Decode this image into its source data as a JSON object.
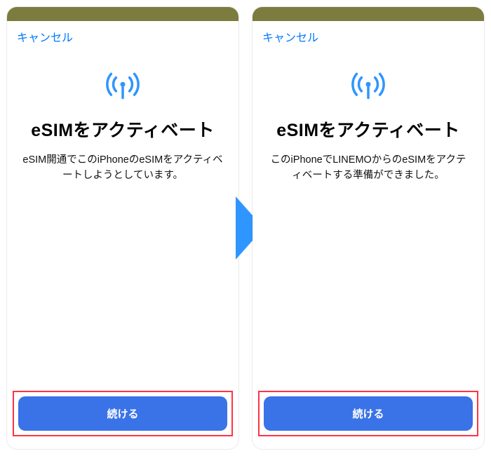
{
  "colors": {
    "accent": "#007aff",
    "primary_button": "#3a72e8",
    "highlight_border": "#ff3344",
    "top_strip": "#7b7c3e",
    "arrow": "#2f95ff"
  },
  "left_screen": {
    "cancel_label": "キャンセル",
    "heading": "eSIMをアクティベート",
    "description": "eSIM開通でこのiPhoneのeSIMをアクティベートしようとしています。",
    "continue_label": "続ける"
  },
  "right_screen": {
    "cancel_label": "キャンセル",
    "heading": "eSIMをアクティベート",
    "description": "このiPhoneでLINEMOからのeSIMをアクティベートする準備ができました。",
    "continue_label": "続ける"
  }
}
